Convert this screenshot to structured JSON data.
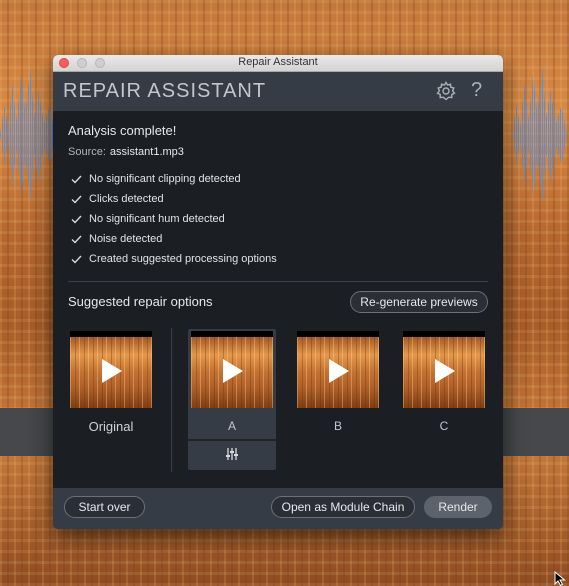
{
  "window": {
    "title": "Repair Assistant"
  },
  "header": {
    "title": "REPAIR ASSISTANT",
    "help_glyph": "?"
  },
  "analysis": {
    "title": "Analysis complete!",
    "source_label": "Source:",
    "source_file": "assistant1.mp3",
    "checks": [
      "No significant clipping detected",
      "Clicks detected",
      "No significant hum detected",
      "Noise detected",
      "Created suggested processing options"
    ]
  },
  "suggestions": {
    "title": "Suggested repair options",
    "regenerate_label": "Re-generate previews",
    "options": {
      "original": "Original",
      "a": "A",
      "b": "B",
      "c": "C"
    },
    "selected": "A"
  },
  "footer": {
    "start_over": "Start over",
    "module_chain": "Open as Module Chain",
    "render": "Render"
  },
  "icons": {
    "gear": "gear-icon",
    "help": "help-icon",
    "check": "check-icon",
    "play": "play-icon",
    "mixer": "mixer-icon"
  },
  "colors": {
    "window_bg": "#1f2328",
    "header_bg": "#353c45",
    "accent_selected": "#353c45"
  }
}
